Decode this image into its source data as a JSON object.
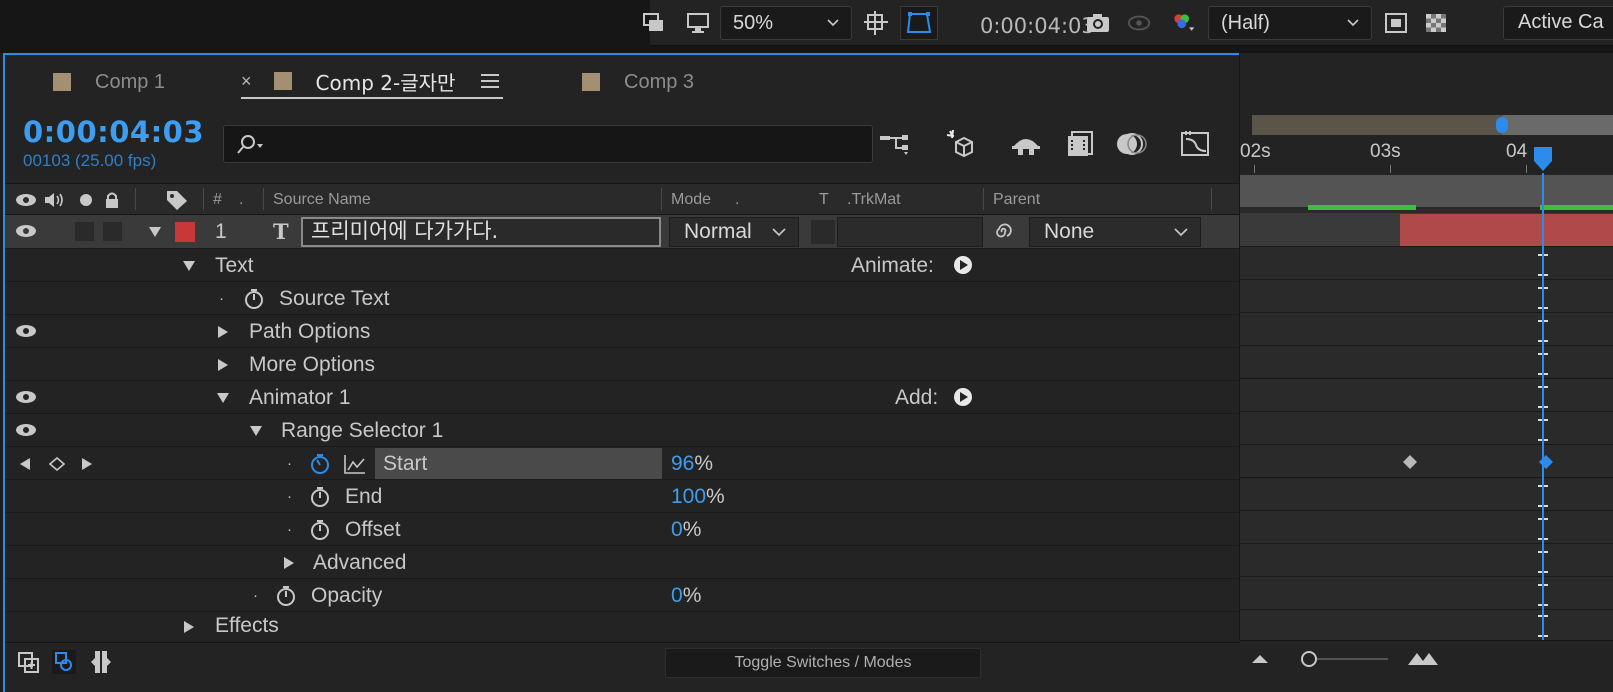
{
  "viewer_toolbar": {
    "zoom_value": "50%",
    "timecode": "0:00:04:03",
    "resolution_value": "(Half)",
    "view_value": "Active Ca"
  },
  "tabs": [
    {
      "label": "Comp 1",
      "active": false
    },
    {
      "label": "Comp 2-글자만",
      "active": true
    },
    {
      "label": "Comp 3",
      "active": false
    }
  ],
  "time": {
    "current": "0:00:04:03",
    "frame_info": "00103 (25.00 fps)"
  },
  "search": {
    "placeholder": ""
  },
  "columns": {
    "hash": "#",
    "source_name": "Source Name",
    "mode": "Mode",
    "t": "T",
    "trkmat": ".TrkMat",
    "parent": "Parent"
  },
  "layer": {
    "number": "1",
    "type_glyph": "T",
    "name": "프리미어에 다가가다.",
    "mode": "Normal",
    "parent": "None",
    "label_color": "#c83838"
  },
  "properties": {
    "text": "Text",
    "animate_label": "Animate:",
    "source_text": "Source Text",
    "path_options": "Path Options",
    "more_options": "More Options",
    "animator": "Animator 1",
    "add_label": "Add:",
    "range_selector": "Range Selector 1",
    "start": {
      "label": "Start",
      "value": "96",
      "unit": "%"
    },
    "end": {
      "label": "End",
      "value": "100",
      "unit": "%"
    },
    "offset": {
      "label": "Offset",
      "value": "0",
      "unit": "%"
    },
    "advanced": "Advanced",
    "opacity": {
      "label": "Opacity",
      "value": "0",
      "unit": "%"
    },
    "effects": "Effects"
  },
  "timeline": {
    "ruler": [
      "02s",
      "03s",
      "04"
    ]
  },
  "bottom": {
    "toggle_label": "Toggle Switches / Modes"
  },
  "colors": {
    "accent": "#2d8ceb",
    "value_blue": "#3d9df0",
    "comp_swatch": "#a38f72",
    "layer_bar": "#b04a4a",
    "work_area_green": "#3ec03e"
  }
}
